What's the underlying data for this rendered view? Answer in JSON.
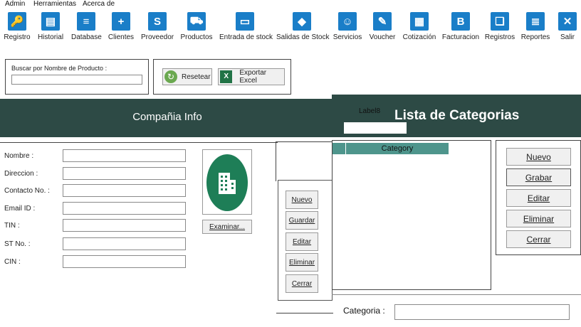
{
  "menubar": {
    "items": [
      "Admin",
      "Herramientas",
      "Acerca de"
    ]
  },
  "toolbar": {
    "buttons": [
      {
        "label": "Registro",
        "icon": "key-icon",
        "glyph": "🔑"
      },
      {
        "label": "Historial",
        "icon": "id-card-icon",
        "glyph": "▤"
      },
      {
        "label": "Database",
        "icon": "database-icon",
        "glyph": "≡"
      },
      {
        "label": "Clientes",
        "icon": "add-user-icon",
        "glyph": "+"
      },
      {
        "label": "Proveedor",
        "icon": "supplier-icon",
        "glyph": "S"
      },
      {
        "label": "Productos",
        "icon": "cart-icon",
        "glyph": "⛟"
      },
      {
        "label": "Entrada de stock",
        "icon": "inbox-icon",
        "glyph": "▭"
      },
      {
        "label": "Salidas de Stock",
        "icon": "tag-icon",
        "glyph": "◆"
      },
      {
        "label": "Servicios",
        "icon": "smiley-icon",
        "glyph": "☺"
      },
      {
        "label": "Voucher",
        "icon": "voucher-icon",
        "glyph": "✎"
      },
      {
        "label": "Cotización",
        "icon": "calculator-icon",
        "glyph": "▦"
      },
      {
        "label": "Facturacion",
        "icon": "invoice-icon",
        "glyph": "B"
      },
      {
        "label": "Registros",
        "icon": "book-icon",
        "glyph": "❑"
      },
      {
        "label": "Reportes",
        "icon": "report-icon",
        "glyph": "≣"
      },
      {
        "label": "Salir",
        "icon": "close-icon",
        "glyph": "✕"
      }
    ]
  },
  "search": {
    "label": "Buscar por Nombre de Producto :",
    "value": "",
    "reset_label": "Resetear",
    "export_label": "Exportar Excel"
  },
  "company": {
    "header": "Compañia Info",
    "fields": [
      {
        "label": "Nombre :",
        "value": ""
      },
      {
        "label": "Direccion :",
        "value": ""
      },
      {
        "label": "Contacto No. :",
        "value": ""
      },
      {
        "label": "Email ID :",
        "value": ""
      },
      {
        "label": "TIN :",
        "value": ""
      },
      {
        "label": "ST No. :",
        "value": ""
      },
      {
        "label": "CIN :",
        "value": ""
      }
    ],
    "browse_label": "Examinar...",
    "actions": [
      "Nuevo",
      "Guardar",
      "Editar",
      "Eliminar",
      "Cerrar"
    ]
  },
  "categories": {
    "label8": "Label8",
    "header": "Lista de Categorias",
    "column": "Category",
    "actions": [
      "Nuevo",
      "Grabar",
      "Editar",
      "Eliminar",
      "Cerrar"
    ],
    "field_label": "Categoria :",
    "field_value": ""
  },
  "colors": {
    "header_bg": "#2d4a45",
    "toolbar_icon": "#1a7ec8",
    "column_header": "#4e958c",
    "logo_green": "#1e7e57"
  }
}
